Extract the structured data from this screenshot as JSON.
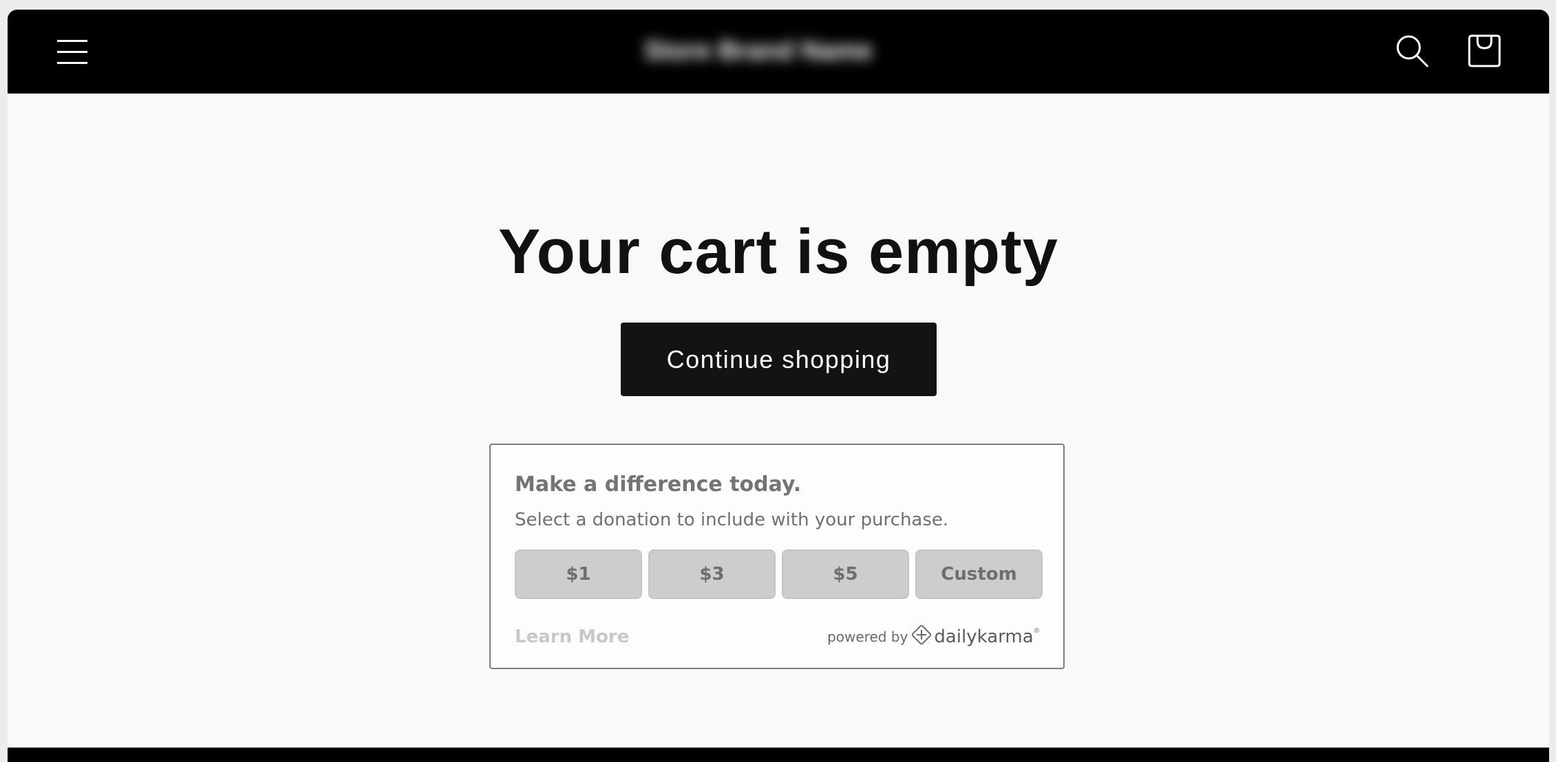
{
  "header": {
    "menu_icon": "hamburger-menu-icon",
    "store_name": "Store Brand Name",
    "search_icon": "search-icon",
    "cart_icon": "shopping-bag-icon"
  },
  "main": {
    "title": "Your cart is empty",
    "continue_label": "Continue shopping"
  },
  "donation": {
    "title": "Make a difference today.",
    "subtitle": "Select a donation to include with your purchase.",
    "amounts": [
      "$1",
      "$3",
      "$5",
      "Custom"
    ],
    "learn_more": "Learn More",
    "powered_by": "powered by",
    "brand": "dailykarma",
    "brand_mark": "®"
  },
  "colors": {
    "header_bg": "#000000",
    "page_bg": "#f9f9f8",
    "button_bg": "#131313",
    "amount_bg": "#cdcdcd"
  }
}
